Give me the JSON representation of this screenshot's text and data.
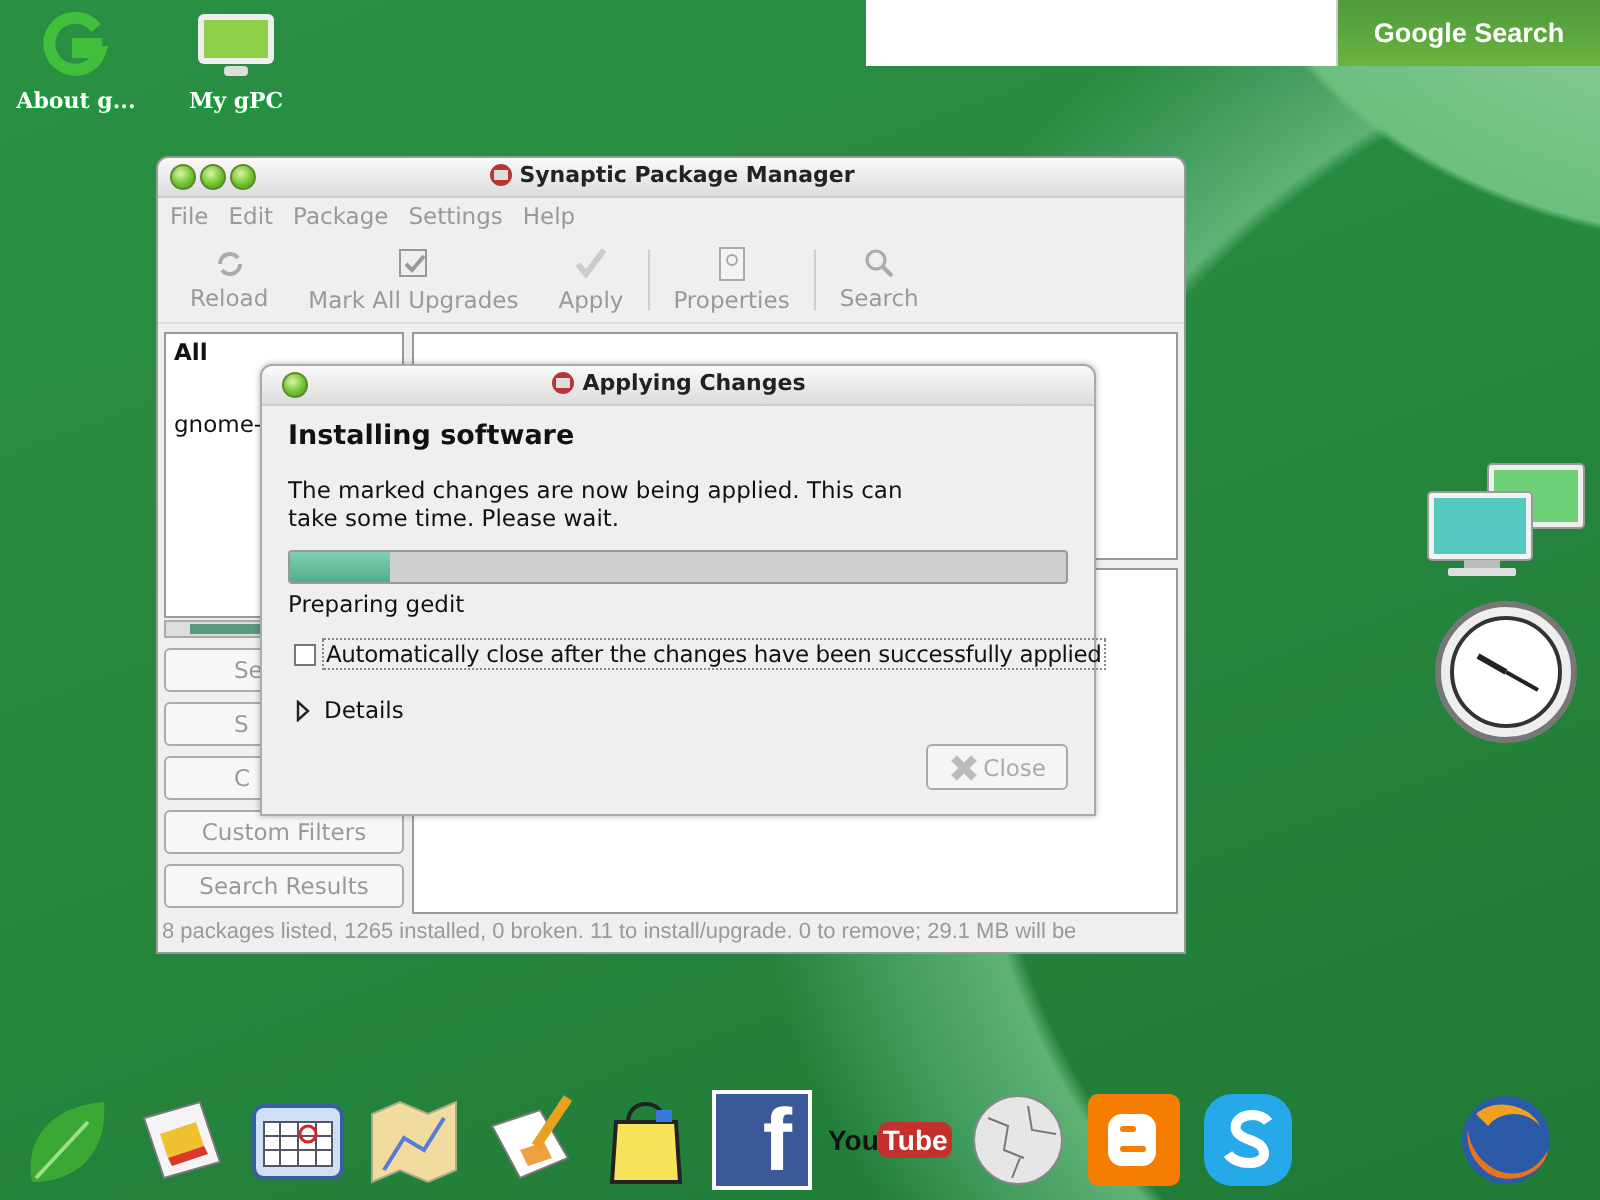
{
  "desktop_icons": [
    {
      "kind": "g-logo",
      "label": "About g..."
    },
    {
      "kind": "monitor",
      "label": "My gPC"
    }
  ],
  "search": {
    "button": "Google Search"
  },
  "synaptic": {
    "title": "Synaptic Package Manager",
    "menu": [
      "File",
      "Edit",
      "Package",
      "Settings",
      "Help"
    ],
    "toolbar": [
      {
        "kind": "reload",
        "label": "Reload",
        "disabled": true
      },
      {
        "kind": "mark",
        "label": "Mark All Upgrades",
        "disabled": true
      },
      {
        "kind": "apply",
        "label": "Apply",
        "disabled": true
      },
      {
        "kind": "properties",
        "label": "Properties",
        "disabled": true
      },
      {
        "kind": "search",
        "label": "Search",
        "disabled": true
      }
    ],
    "filter_list": [
      {
        "kind": "heading",
        "label": "All"
      },
      {
        "kind": "item",
        "label": "gnome-"
      }
    ],
    "filter_buttons": [
      {
        "kind": "covered",
        "label": "Se"
      },
      {
        "kind": "covered",
        "label": "S"
      },
      {
        "kind": "covered",
        "label": "C"
      },
      {
        "kind": "full",
        "label": "Custom Filters"
      },
      {
        "kind": "full",
        "label": "Search Results"
      }
    ],
    "status_bar": "8 packages listed, 1265 installed, 0 broken. 11 to install/upgrade. 0 to remove; 29.1 MB will be"
  },
  "dialog": {
    "title": "Applying Changes",
    "heading": "Installing software",
    "message": "The marked changes are now being applied. This can take some time. Please wait.",
    "progress": {
      "level": 0.13
    },
    "status": "Preparing gedit",
    "auto_close": {
      "label": "Automatically close after the changes have been successfully applied",
      "checked": false
    },
    "details": {
      "label": "Details",
      "expanded": false
    },
    "close_button": {
      "label": "Close",
      "disabled": true
    }
  },
  "dock": [
    {
      "kind": "leaf"
    },
    {
      "kind": "newspaper"
    },
    {
      "kind": "calendar"
    },
    {
      "kind": "map"
    },
    {
      "kind": "spreadsheet"
    },
    {
      "kind": "bag"
    },
    {
      "kind": "facebook",
      "text": "f"
    },
    {
      "kind": "youtube",
      "text": "You",
      "text_2": "Tube"
    },
    {
      "kind": "globe"
    },
    {
      "kind": "blogger"
    },
    {
      "kind": "skype"
    },
    {
      "kind": "firefox"
    }
  ]
}
